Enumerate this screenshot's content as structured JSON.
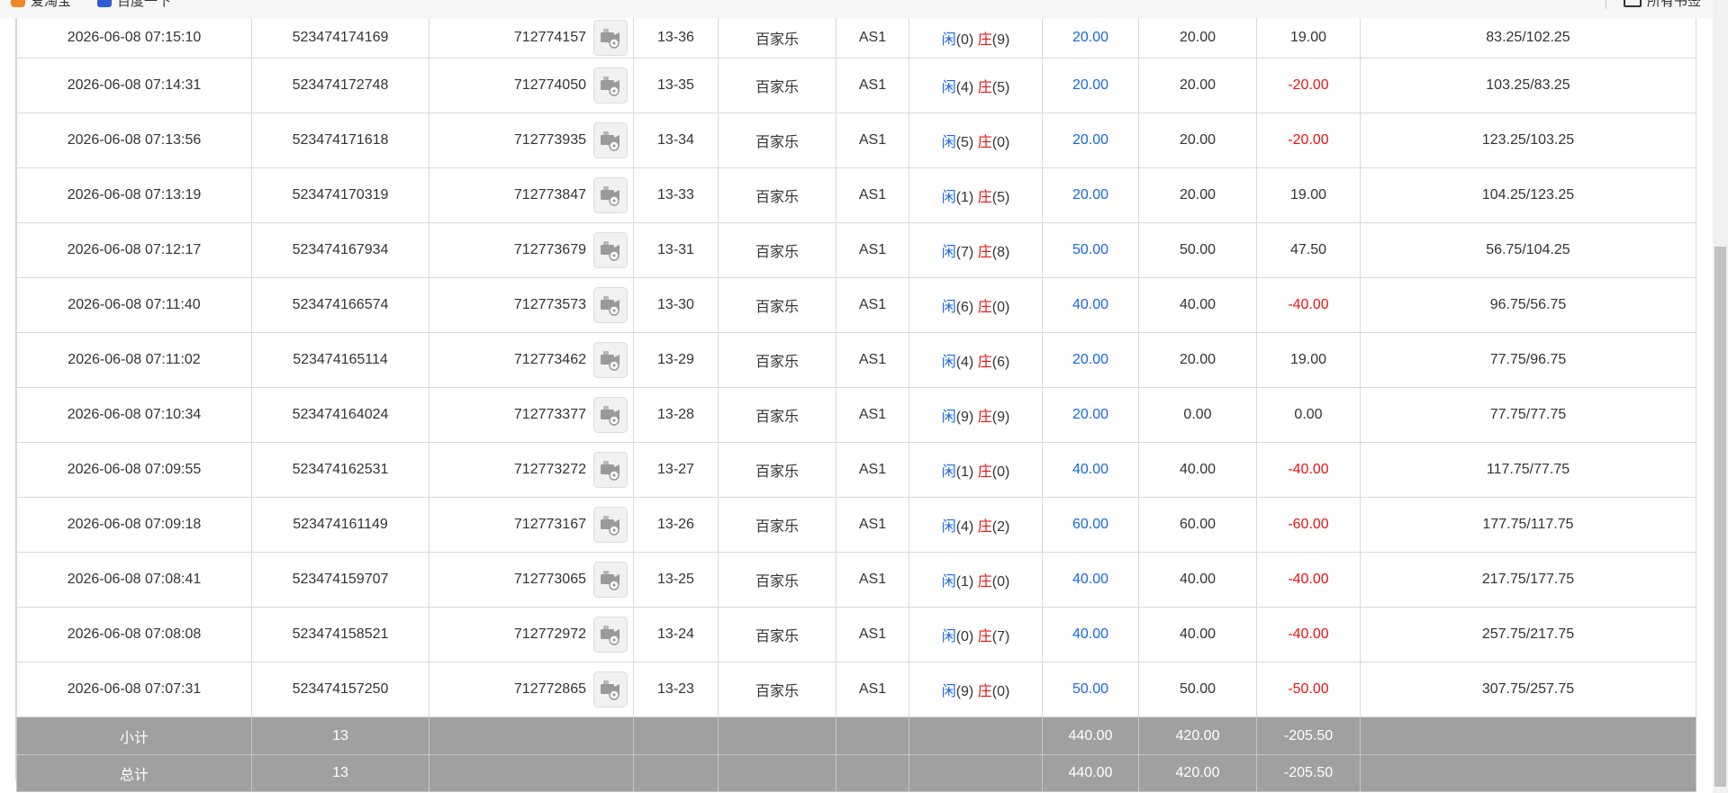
{
  "browser": {
    "bookmark_left_1": "爱淘宝",
    "bookmark_left_2": "百度一下",
    "bookmark_right": "所有书签"
  },
  "colors": {
    "bet_blue": "#1a66e6",
    "loss_red": "#ee1111",
    "summary_bg": "#a0a0a0"
  },
  "icons": {
    "video_icon": "video-camera-icon"
  },
  "rows": [
    {
      "time": "2026-06-08 07:15:10",
      "order": "523474174169",
      "game": "712774157",
      "shoe": "13-36",
      "type": "百家乐",
      "table": "AS1",
      "player_label": "闲",
      "player_num": "(0)",
      "banker_label": "庄",
      "banker_num": "(9)",
      "bet": "20.00",
      "valid": "20.00",
      "win": "19.00",
      "win_neg": false,
      "balance": "83.25/102.25"
    },
    {
      "time": "2026-06-08 07:14:31",
      "order": "523474172748",
      "game": "712774050",
      "shoe": "13-35",
      "type": "百家乐",
      "table": "AS1",
      "player_label": "闲",
      "player_num": "(4)",
      "banker_label": "庄",
      "banker_num": "(5)",
      "bet": "20.00",
      "valid": "20.00",
      "win": "-20.00",
      "win_neg": true,
      "balance": "103.25/83.25"
    },
    {
      "time": "2026-06-08 07:13:56",
      "order": "523474171618",
      "game": "712773935",
      "shoe": "13-34",
      "type": "百家乐",
      "table": "AS1",
      "player_label": "闲",
      "player_num": "(5)",
      "banker_label": "庄",
      "banker_num": "(0)",
      "bet": "20.00",
      "valid": "20.00",
      "win": "-20.00",
      "win_neg": true,
      "balance": "123.25/103.25"
    },
    {
      "time": "2026-06-08 07:13:19",
      "order": "523474170319",
      "game": "712773847",
      "shoe": "13-33",
      "type": "百家乐",
      "table": "AS1",
      "player_label": "闲",
      "player_num": "(1)",
      "banker_label": "庄",
      "banker_num": "(5)",
      "bet": "20.00",
      "valid": "20.00",
      "win": "19.00",
      "win_neg": false,
      "balance": "104.25/123.25"
    },
    {
      "time": "2026-06-08 07:12:17",
      "order": "523474167934",
      "game": "712773679",
      "shoe": "13-31",
      "type": "百家乐",
      "table": "AS1",
      "player_label": "闲",
      "player_num": "(7)",
      "banker_label": "庄",
      "banker_num": "(8)",
      "bet": "50.00",
      "valid": "50.00",
      "win": "47.50",
      "win_neg": false,
      "balance": "56.75/104.25"
    },
    {
      "time": "2026-06-08 07:11:40",
      "order": "523474166574",
      "game": "712773573",
      "shoe": "13-30",
      "type": "百家乐",
      "table": "AS1",
      "player_label": "闲",
      "player_num": "(6)",
      "banker_label": "庄",
      "banker_num": "(0)",
      "bet": "40.00",
      "valid": "40.00",
      "win": "-40.00",
      "win_neg": true,
      "balance": "96.75/56.75"
    },
    {
      "time": "2026-06-08 07:11:02",
      "order": "523474165114",
      "game": "712773462",
      "shoe": "13-29",
      "type": "百家乐",
      "table": "AS1",
      "player_label": "闲",
      "player_num": "(4)",
      "banker_label": "庄",
      "banker_num": "(6)",
      "bet": "20.00",
      "valid": "20.00",
      "win": "19.00",
      "win_neg": false,
      "balance": "77.75/96.75"
    },
    {
      "time": "2026-06-08 07:10:34",
      "order": "523474164024",
      "game": "712773377",
      "shoe": "13-28",
      "type": "百家乐",
      "table": "AS1",
      "player_label": "闲",
      "player_num": "(9)",
      "banker_label": "庄",
      "banker_num": "(9)",
      "bet": "20.00",
      "valid": "0.00",
      "win": "0.00",
      "win_neg": false,
      "balance": "77.75/77.75"
    },
    {
      "time": "2026-06-08 07:09:55",
      "order": "523474162531",
      "game": "712773272",
      "shoe": "13-27",
      "type": "百家乐",
      "table": "AS1",
      "player_label": "闲",
      "player_num": "(1)",
      "banker_label": "庄",
      "banker_num": "(0)",
      "bet": "40.00",
      "valid": "40.00",
      "win": "-40.00",
      "win_neg": true,
      "balance": "117.75/77.75"
    },
    {
      "time": "2026-06-08 07:09:18",
      "order": "523474161149",
      "game": "712773167",
      "shoe": "13-26",
      "type": "百家乐",
      "table": "AS1",
      "player_label": "闲",
      "player_num": "(4)",
      "banker_label": "庄",
      "banker_num": "(2)",
      "bet": "60.00",
      "valid": "60.00",
      "win": "-60.00",
      "win_neg": true,
      "balance": "177.75/117.75"
    },
    {
      "time": "2026-06-08 07:08:41",
      "order": "523474159707",
      "game": "712773065",
      "shoe": "13-25",
      "type": "百家乐",
      "table": "AS1",
      "player_label": "闲",
      "player_num": "(1)",
      "banker_label": "庄",
      "banker_num": "(0)",
      "bet": "40.00",
      "valid": "40.00",
      "win": "-40.00",
      "win_neg": true,
      "balance": "217.75/177.75"
    },
    {
      "time": "2026-06-08 07:08:08",
      "order": "523474158521",
      "game": "712772972",
      "shoe": "13-24",
      "type": "百家乐",
      "table": "AS1",
      "player_label": "闲",
      "player_num": "(0)",
      "banker_label": "庄",
      "banker_num": "(7)",
      "bet": "40.00",
      "valid": "40.00",
      "win": "-40.00",
      "win_neg": true,
      "balance": "257.75/217.75"
    },
    {
      "time": "2026-06-08 07:07:31",
      "order": "523474157250",
      "game": "712772865",
      "shoe": "13-23",
      "type": "百家乐",
      "table": "AS1",
      "player_label": "闲",
      "player_num": "(9)",
      "banker_label": "庄",
      "banker_num": "(0)",
      "bet": "50.00",
      "valid": "50.00",
      "win": "-50.00",
      "win_neg": true,
      "balance": "307.75/257.75"
    }
  ],
  "subtotal": {
    "label": "小计",
    "count": "13",
    "bet": "440.00",
    "valid": "420.00",
    "win": "-205.50"
  },
  "total": {
    "label": "总计",
    "count": "13",
    "bet": "440.00",
    "valid": "420.00",
    "win": "-205.50"
  }
}
